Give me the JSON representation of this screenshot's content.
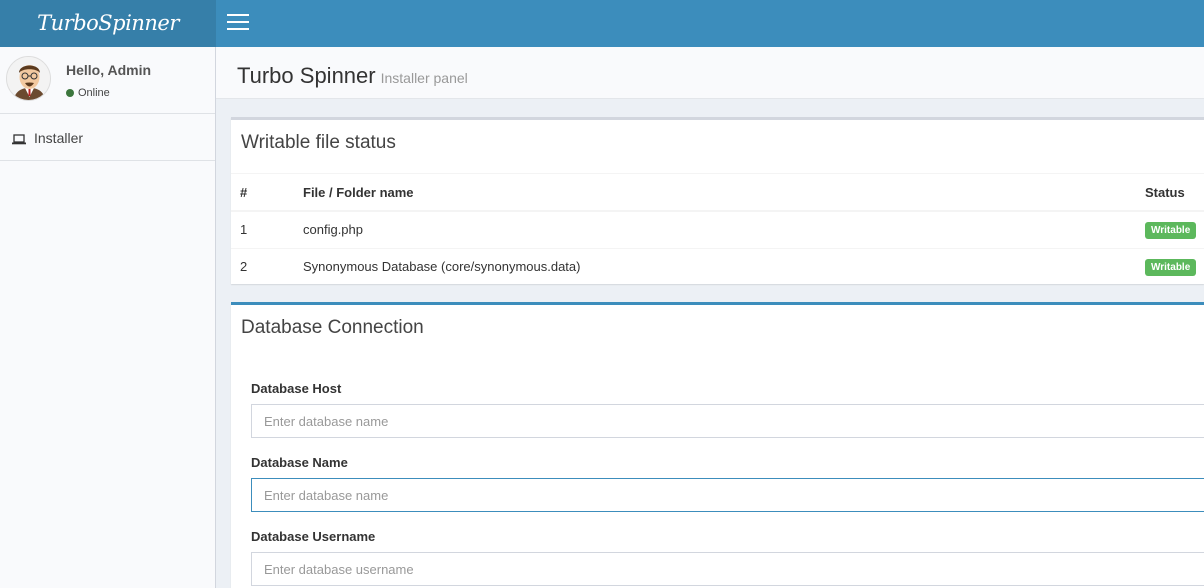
{
  "header": {
    "logo": "TurboSpinner"
  },
  "sidebar": {
    "user": {
      "greeting": "Hello, Admin",
      "status": "Online"
    },
    "items": [
      {
        "label": "Installer",
        "icon": "laptop-icon"
      }
    ]
  },
  "content_header": {
    "title": "Turbo Spinner",
    "subtitle": "Installer panel"
  },
  "writable_box": {
    "title": "Writable file status",
    "columns": [
      "#",
      "File / Folder name",
      "Status"
    ],
    "rows": [
      {
        "num": "1",
        "name": "config.php",
        "status": "Writable"
      },
      {
        "num": "2",
        "name": "Synonymous Database (core/synonymous.data)",
        "status": "Writable"
      }
    ]
  },
  "db_box": {
    "title": "Database Connection",
    "fields": [
      {
        "label": "Database Host",
        "placeholder": "Enter database name"
      },
      {
        "label": "Database Name",
        "placeholder": "Enter database name"
      },
      {
        "label": "Database Username",
        "placeholder": "Enter database username"
      }
    ]
  },
  "colors": {
    "header": "#3c8dbc",
    "logo_bg": "#367fa9",
    "badge": "#5cb85c",
    "online": "#3c763d"
  }
}
